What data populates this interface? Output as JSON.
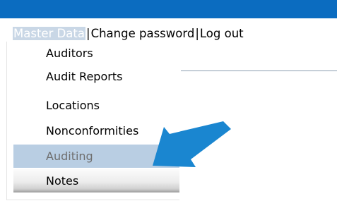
{
  "menu": {
    "master_data": "Master Data",
    "separator": "|",
    "change_password": "Change password",
    "log_out": "Log out"
  },
  "dropdown": {
    "items": [
      {
        "label": "Auditors"
      },
      {
        "label": "Audit Reports"
      },
      {
        "label": "Locations"
      },
      {
        "label": "Nonconformities"
      },
      {
        "label": "Auditing"
      },
      {
        "label": "Notes"
      }
    ]
  },
  "colors": {
    "top_bar": "#0b6cc0",
    "arrow": "#1a86d0",
    "highlight": "#b9cee3"
  },
  "icons": {
    "annotation": "arrow-icon"
  }
}
